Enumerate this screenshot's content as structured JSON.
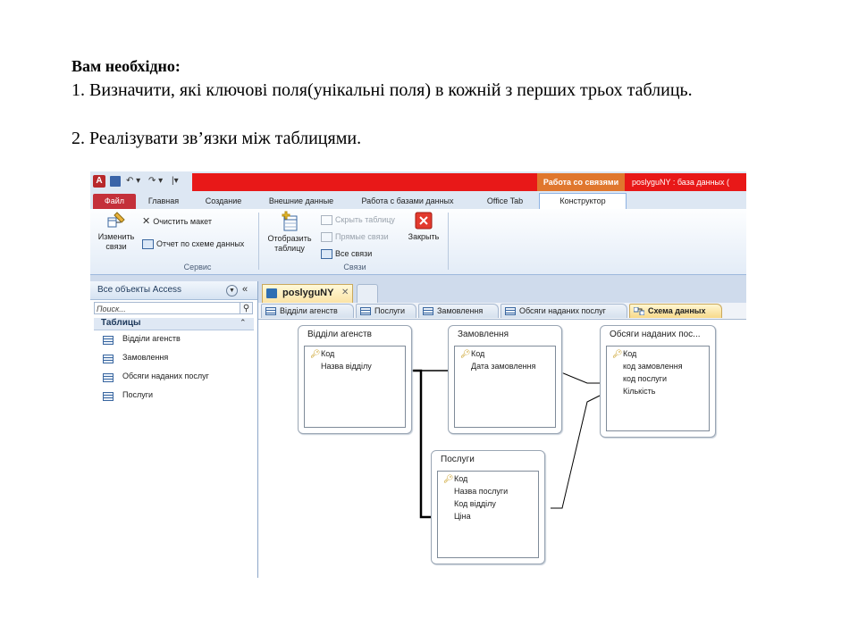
{
  "slide": {
    "title": "Вам необхідно:",
    "line1": "1. Визначити, які ключові поля(унікальні поля) в кожній з перших трьох таблиць.",
    "line2": "2. Реалізувати зв’язки між таблицями."
  },
  "app": {
    "contextual_tab": "Работа со связями",
    "window_title": "poslyguNY : база данных (",
    "qat": {
      "logo": "A",
      "undo": "↶ ▾",
      "redo": "↷ ▾",
      "customize": "|▾"
    }
  },
  "ribbon_tabs": [
    "Файл",
    "Главная",
    "Создание",
    "Внешние данные",
    "Работа с базами данных",
    "Office Tab",
    "Конструктор"
  ],
  "ribbon": {
    "edit_relations": "Изменить связи",
    "clear_layout": "Очистить макет",
    "relation_report": "Отчет по схеме данных",
    "group_tools": "Сервис",
    "show_table": "Отобразить таблицу",
    "hide_table": "Скрыть таблицу",
    "direct_relations": "Прямые связи",
    "all_relations": "Все связи",
    "close": "Закрыть",
    "group_relations": "Связи"
  },
  "nav": {
    "title": "Все объекты Access",
    "search_placeholder": "Поиск...",
    "group": "Таблицы",
    "items": [
      "Відділи агенств",
      "Замовлення",
      "Обсяги наданих послуг",
      "Послуги"
    ]
  },
  "document": {
    "tab": "poslyguNY",
    "object_tabs": [
      "Відділи агенств",
      "Послуги",
      "Замовлення",
      "Обсяги наданих послуг",
      "Схема данных"
    ]
  },
  "relationship_tables": [
    {
      "title": "Відділи агенств",
      "fields": [
        "Код",
        "Назва відділу"
      ],
      "key_index": 0
    },
    {
      "title": "Замовлення",
      "fields": [
        "Код",
        "Дата замовлення"
      ],
      "key_index": 0
    },
    {
      "title": "Обсяги наданих пос...",
      "fields": [
        "Код",
        "код замовлення",
        "код послуги",
        "Кількість"
      ],
      "key_index": 0
    },
    {
      "title": "Послуги",
      "fields": [
        "Код",
        "Назва послуги",
        "Код відділу",
        "Ціна"
      ],
      "key_index": 0
    }
  ]
}
